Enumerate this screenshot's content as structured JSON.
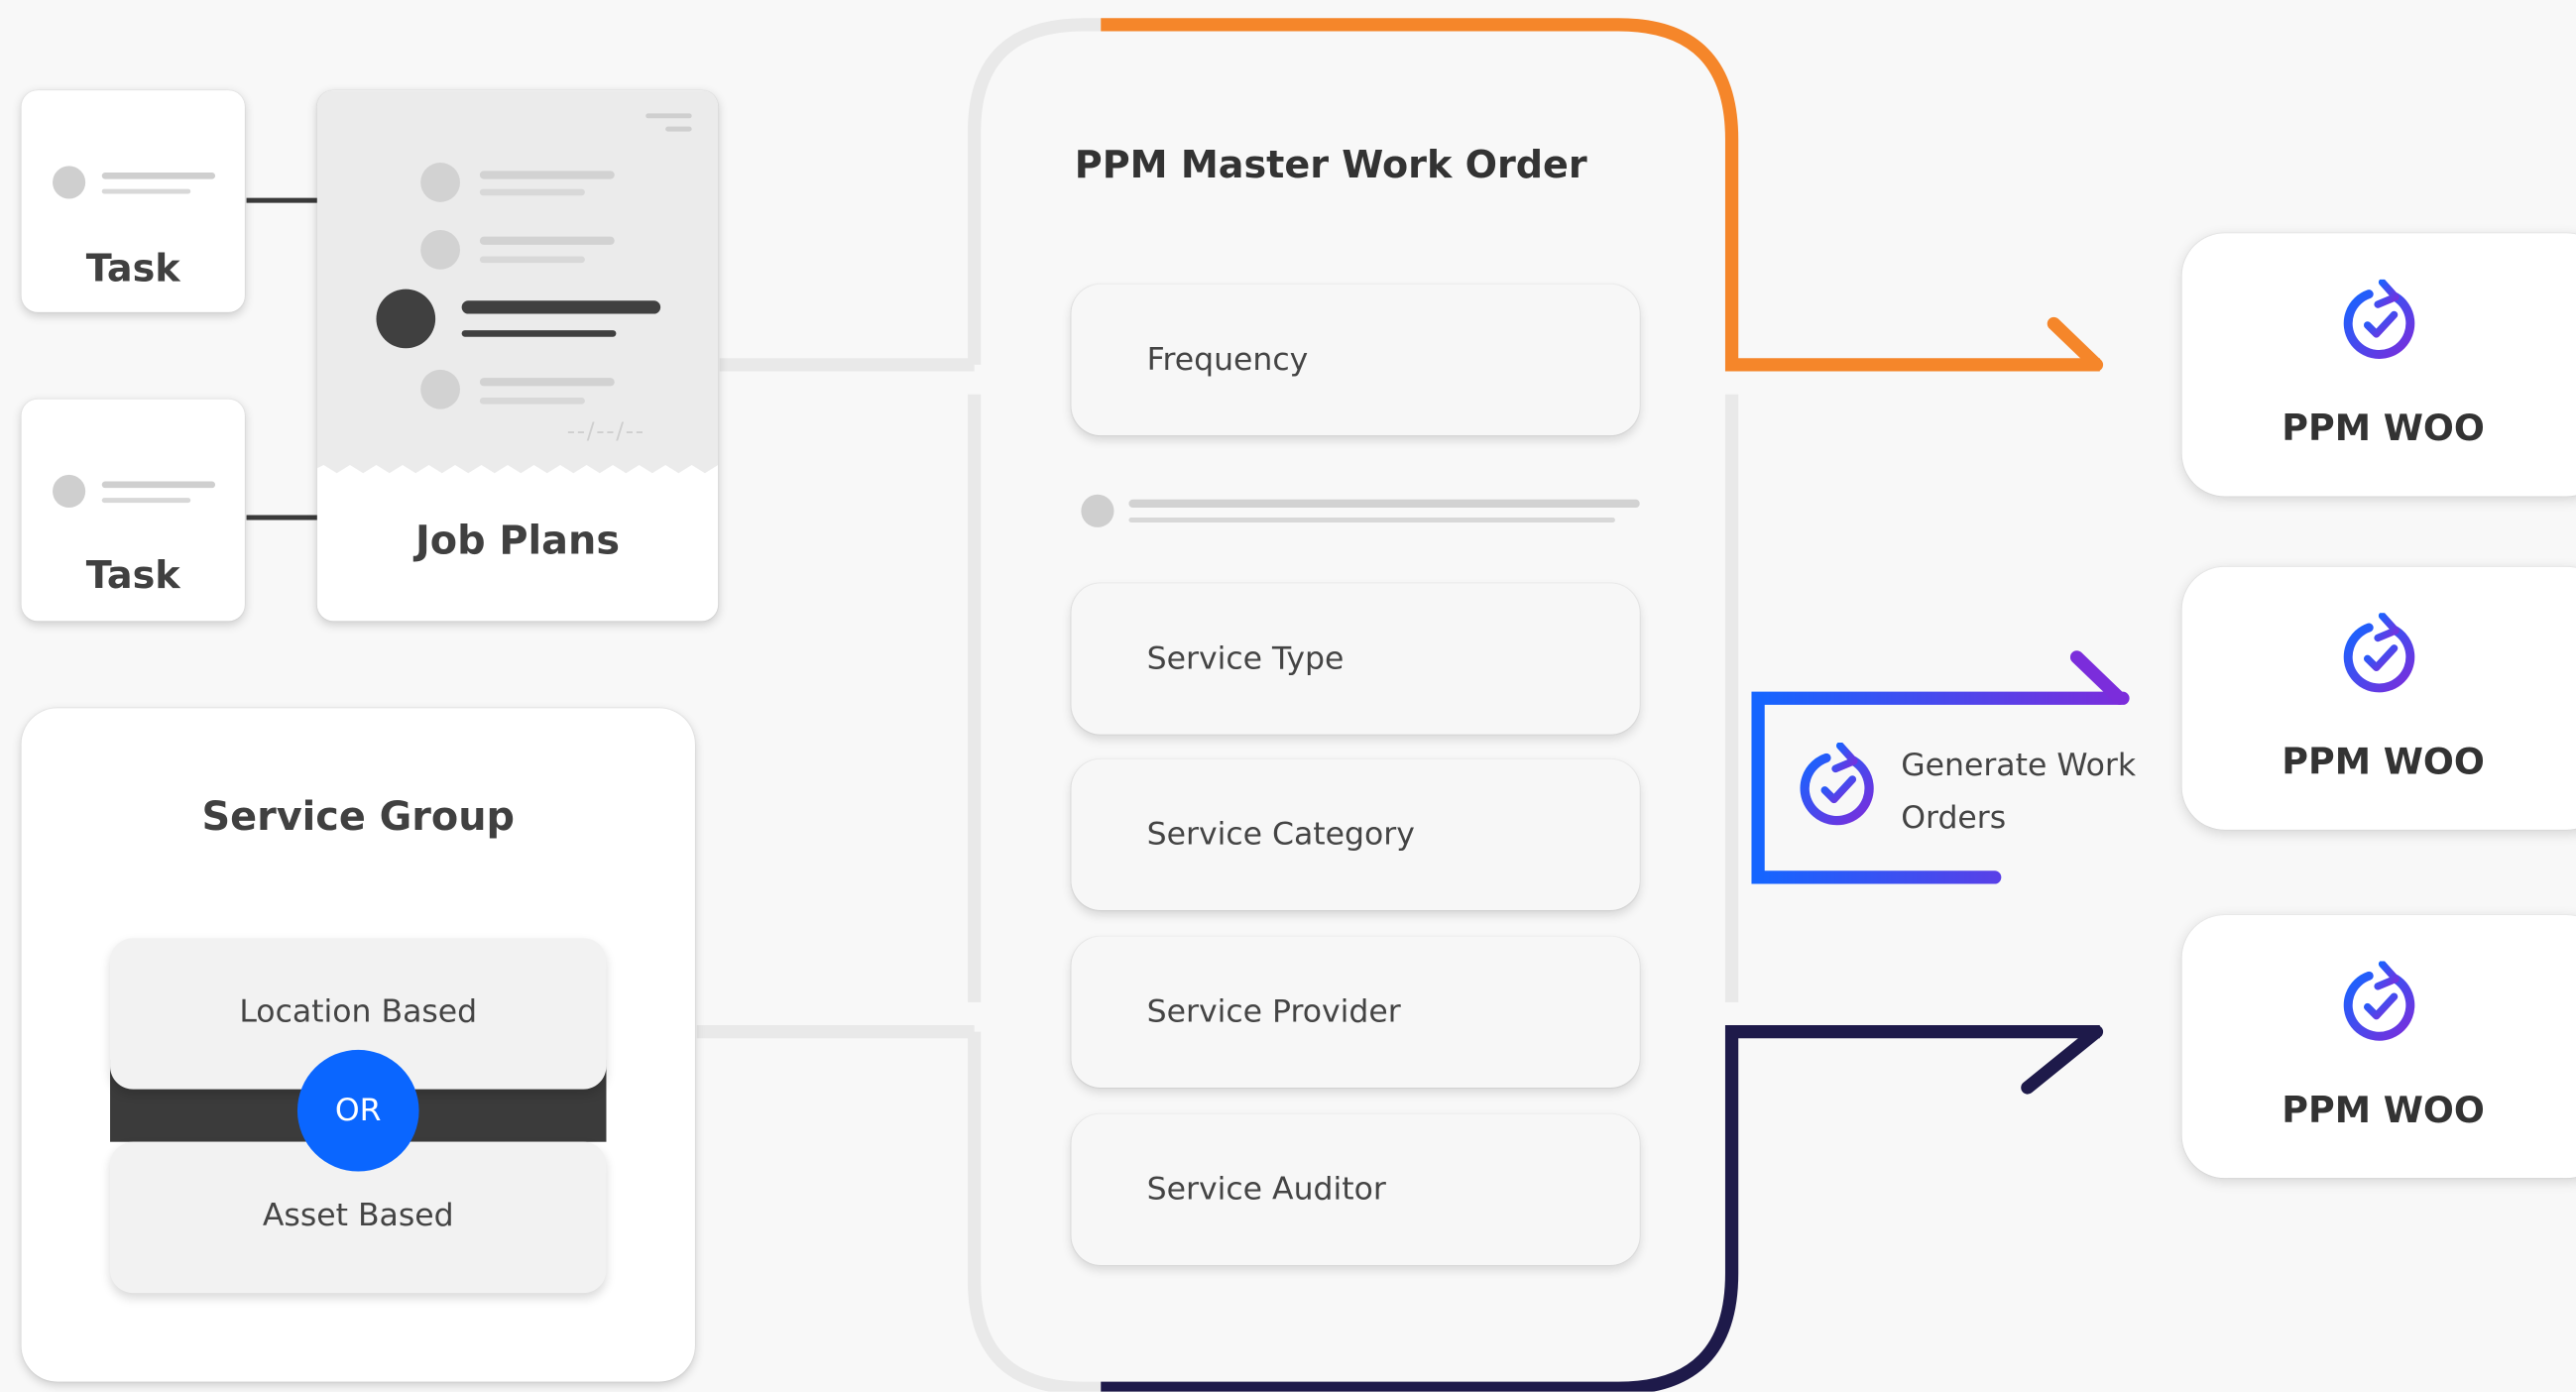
{
  "colors": {
    "orange": "#f5862a",
    "navy": "#1e1a4a",
    "blue": "#1565ff",
    "purple": "#7b2ddb",
    "or_badge": "#0a66ff",
    "dark_bar": "#3b3b3b"
  },
  "tasks": [
    {
      "label": "Task"
    },
    {
      "label": "Task"
    }
  ],
  "job_plans": {
    "label": "Job Plans",
    "date_placeholder": "--/--/--"
  },
  "service_group": {
    "title": "Service Group",
    "option_a": "Location Based",
    "option_b": "Asset Based",
    "or_label": "OR"
  },
  "master": {
    "title": "PPM Master Work Order",
    "fields": [
      {
        "label": "Frequency"
      },
      {
        "label": "Service Type"
      },
      {
        "label": "Service Category"
      },
      {
        "label": "Service Provider"
      },
      {
        "label": "Service Auditor"
      }
    ]
  },
  "generate": {
    "line1": "Generate Work",
    "line2": "Orders",
    "icon": "refresh-check-icon"
  },
  "outputs": [
    {
      "label": "PPM WOO",
      "icon": "refresh-check-icon"
    },
    {
      "label": "PPM WOO",
      "icon": "refresh-check-icon"
    },
    {
      "label": "PPM WOO",
      "icon": "refresh-check-icon"
    }
  ]
}
